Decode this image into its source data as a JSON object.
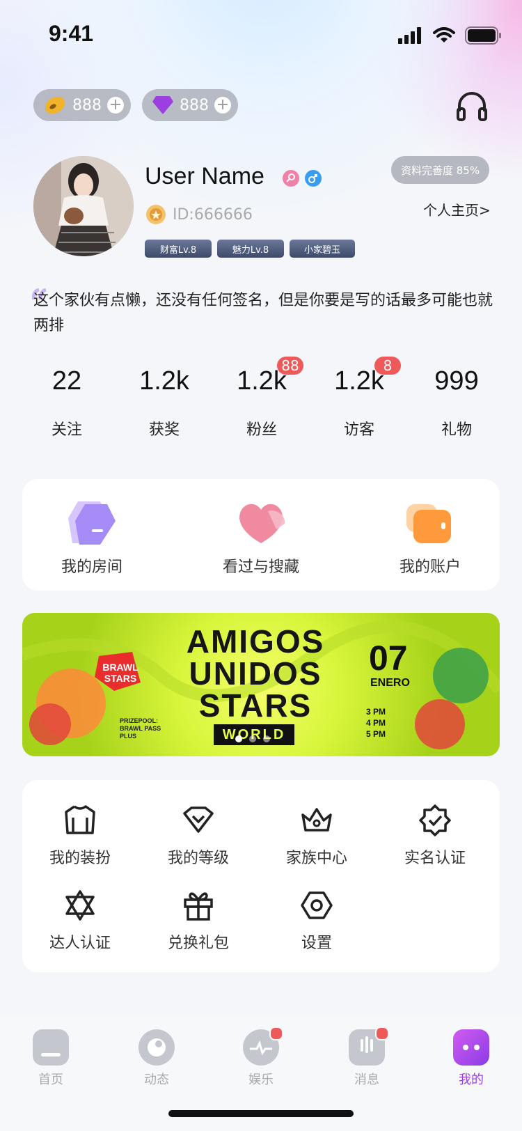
{
  "status_bar": {
    "time": "9:41"
  },
  "wallet": {
    "coins": "888",
    "diamonds": "888",
    "diamond_symbol": "Z",
    "plus": "+"
  },
  "profile": {
    "username": "User Name",
    "id": "ID:666666",
    "completion": "资料完善度 85%",
    "homepage_link": "个人主页>",
    "badges": [
      "财富Lv.8",
      "魅力Lv.8",
      "小家碧玉"
    ],
    "signature": "这个家伙有点懒，还没有任何签名，但是你要是写的话最多可能也就两排"
  },
  "stats": [
    {
      "value": "22",
      "label": "关注"
    },
    {
      "value": "1.2k",
      "label": "获奖"
    },
    {
      "value": "1.2k",
      "label": "粉丝",
      "badge": "88"
    },
    {
      "value": "1.2k",
      "label": "访客",
      "badge": "8"
    },
    {
      "value": "999",
      "label": "礼物"
    }
  ],
  "quick_actions": [
    {
      "label": "我的房间",
      "icon": "room-icon",
      "color": "#a58bf5"
    },
    {
      "label": "看过与搜藏",
      "icon": "heart-icon",
      "color": "#f08aa0"
    },
    {
      "label": "我的账户",
      "icon": "wallet-icon",
      "color": "#ffa040"
    }
  ],
  "banner": {
    "title_lines": [
      "AMIGOS",
      "UNIDOS",
      "STARS"
    ],
    "subtitle": "WORLD",
    "game": "BRAWL STARS",
    "date_day": "07",
    "date_month": "ENERO",
    "times": [
      "3 PM",
      "4 PM",
      "5 PM"
    ],
    "prize": "PRIZEPOOL: BRAWL PASS PLUS"
  },
  "menu": [
    {
      "label": "我的装扮",
      "icon": "shirt-icon"
    },
    {
      "label": "我的等级",
      "icon": "diamond-icon"
    },
    {
      "label": "家族中心",
      "icon": "crown-icon"
    },
    {
      "label": "实名认证",
      "icon": "verified-badge-icon"
    },
    {
      "label": "达人认证",
      "icon": "star-of-david-icon"
    },
    {
      "label": "兑换礼包",
      "icon": "gift-icon"
    },
    {
      "label": "设置",
      "icon": "settings-hexagon-icon"
    }
  ],
  "tabs": [
    {
      "label": "首页",
      "icon": "home-icon"
    },
    {
      "label": "动态",
      "icon": "moments-icon"
    },
    {
      "label": "娱乐",
      "icon": "entertainment-icon"
    },
    {
      "label": "消息",
      "icon": "message-icon"
    },
    {
      "label": "我的",
      "icon": "profile-cat-icon"
    }
  ],
  "colors": {
    "accent": "#9b3fe0",
    "badge_red": "#ee5a5a",
    "inactive": "#aaaaaa"
  }
}
